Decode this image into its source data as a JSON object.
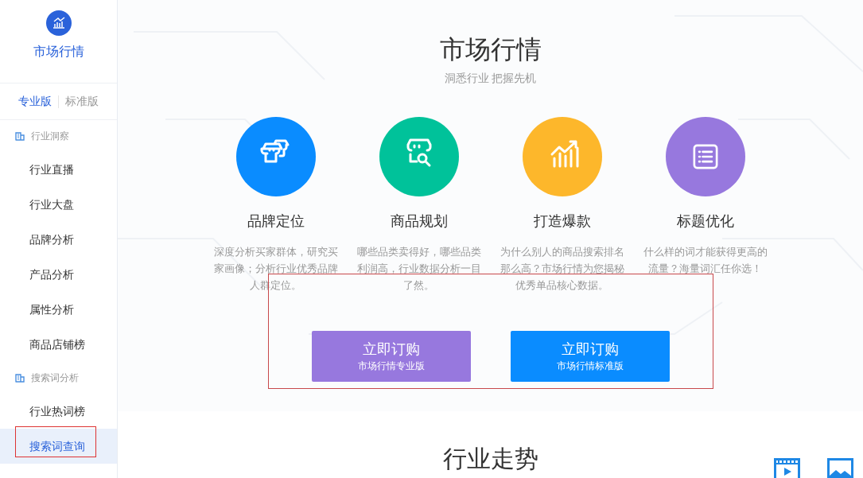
{
  "sidebar": {
    "title": "市场行情",
    "tabs": [
      {
        "label": "专业版",
        "selected": true
      },
      {
        "label": "标准版",
        "selected": false
      }
    ],
    "groups": [
      {
        "label": "行业洞察",
        "items": [
          {
            "label": "行业直播",
            "selected": false
          },
          {
            "label": "行业大盘",
            "selected": false
          },
          {
            "label": "品牌分析",
            "selected": false
          },
          {
            "label": "产品分析",
            "selected": false
          },
          {
            "label": "属性分析",
            "selected": false
          },
          {
            "label": "商品店铺榜",
            "selected": false
          }
        ]
      },
      {
        "label": "搜索词分析",
        "items": [
          {
            "label": "行业热词榜",
            "selected": false
          },
          {
            "label": "搜索词查询",
            "selected": true
          }
        ]
      }
    ]
  },
  "hero": {
    "title": "市场行情",
    "subtitle": "洞悉行业 把握先机"
  },
  "features": [
    {
      "kind": "store",
      "color": "#0a8cff",
      "title": "品牌定位",
      "description": "深度分析买家群体，研究买家画像；分析行业优秀品牌人群定位。"
    },
    {
      "kind": "search",
      "color": "#00c29a",
      "title": "商品规划",
      "description": "哪些品类卖得好，哪些品类利润高，行业数据分析一目了然。"
    },
    {
      "kind": "chart",
      "color": "#fdb72b",
      "title": "打造爆款",
      "description": "为什么别人的商品搜索排名那么高？市场行情为您揭秘优秀单品核心数据。"
    },
    {
      "kind": "list",
      "color": "#9778de",
      "title": "标题优化",
      "description": "什么样的词才能获得更高的流量？海量词汇任你选！"
    }
  ],
  "buttons": [
    {
      "label": "立即订购",
      "sublabel": "市场行情专业版",
      "color": "#9778de"
    },
    {
      "label": "立即订购",
      "sublabel": "市场行情标准版",
      "color": "#0a8cff"
    }
  ],
  "section": {
    "title": "行业走势"
  }
}
